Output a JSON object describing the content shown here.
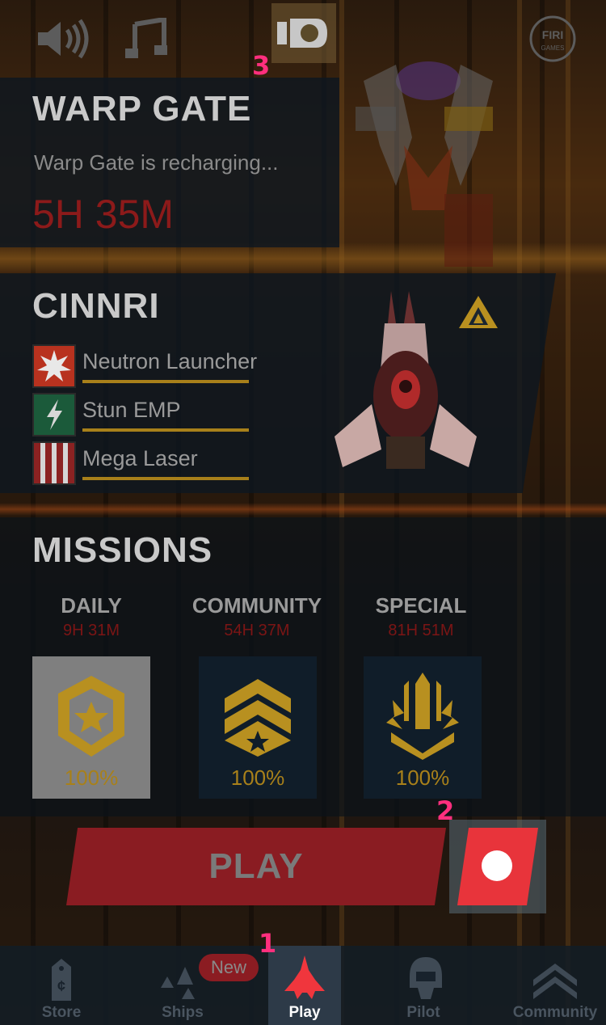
{
  "toolbar": {
    "icons": [
      "speaker-icon",
      "music-icon",
      "camera-icon",
      "firi-games-logo"
    ],
    "logo_text_line1": "FIRI",
    "logo_text_line2": "GAMES"
  },
  "annotations": {
    "one": "1",
    "two": "2",
    "three": "3"
  },
  "warp_gate": {
    "title": "WARP GATE",
    "status": "Warp Gate is recharging...",
    "timer": "5H 35M"
  },
  "ship": {
    "name": "CINNRI",
    "weapons": [
      {
        "name": "Neutron Launcher",
        "icon": "burst-icon"
      },
      {
        "name": "Stun EMP",
        "icon": "lightning-icon"
      },
      {
        "name": "Mega Laser",
        "icon": "laser-icon"
      }
    ]
  },
  "missions": {
    "title": "MISSIONS",
    "items": [
      {
        "label": "DAILY",
        "time": "9H 31M",
        "progress": "100%",
        "icon": "daily-badge-icon"
      },
      {
        "label": "COMMUNITY",
        "time": "54H 37M",
        "progress": "100%",
        "icon": "community-badge-icon"
      },
      {
        "label": "SPECIAL",
        "time": "81H 51M",
        "progress": "100%",
        "icon": "special-badge-icon"
      }
    ]
  },
  "play_button": {
    "label": "PLAY"
  },
  "nav": {
    "items": [
      {
        "label": "Store",
        "icon": "store-tag-icon"
      },
      {
        "label": "Ships",
        "icon": "ships-icon"
      },
      {
        "label": "Play",
        "icon": "play-ship-icon"
      },
      {
        "label": "Pilot",
        "icon": "pilot-helmet-icon"
      },
      {
        "label": "Community",
        "icon": "community-chevron-icon"
      }
    ],
    "new_badge": "New"
  },
  "colors": {
    "accent_red": "#e8343b",
    "annotation_pink": "#ff2f7e",
    "gold": "#a8801a"
  }
}
